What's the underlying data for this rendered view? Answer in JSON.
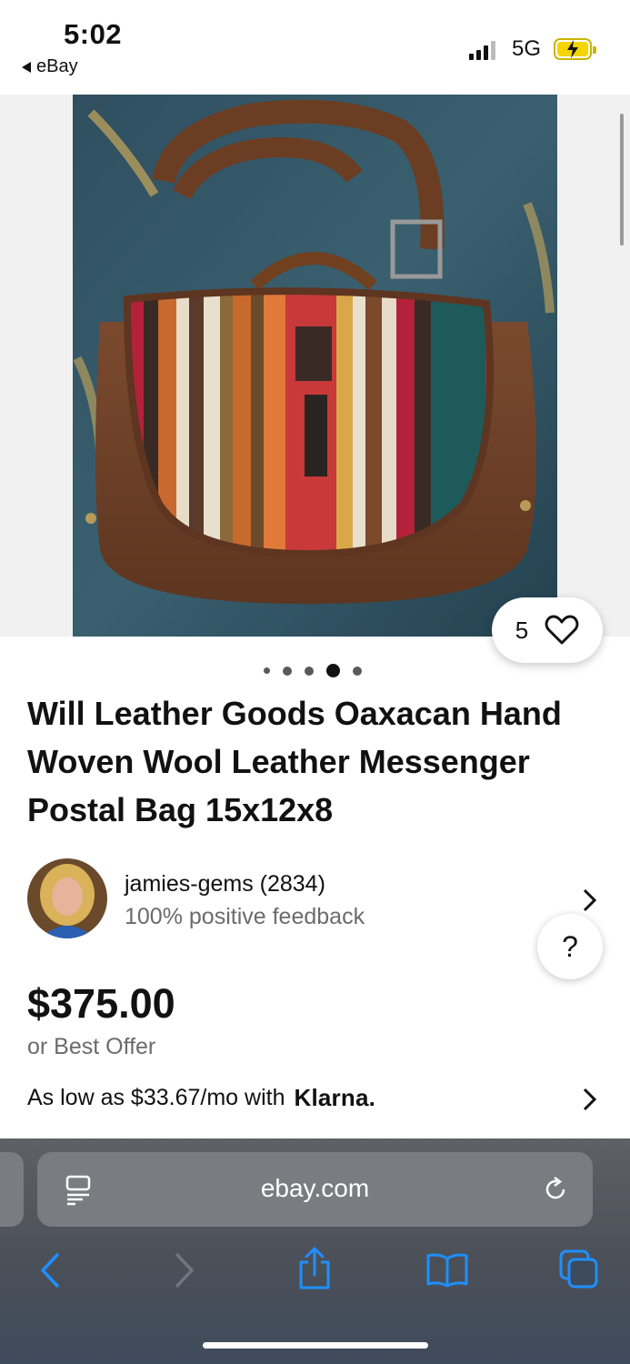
{
  "status_bar": {
    "time": "5:02",
    "back_app": "eBay",
    "network": "5G",
    "battery_state": "charging"
  },
  "gallery": {
    "photo_description_icon": "product-photo",
    "watch_count": "5",
    "page_dots": {
      "count": 5,
      "active_index": 3
    }
  },
  "listing": {
    "title": "Will Leather Goods Oaxacan Hand Woven Wool Leather Messenger Postal Bag 15x12x8",
    "price": "$375.00",
    "best_offer": "or Best Offer",
    "financing_text": "As low as $33.67/mo with",
    "financing_brand": "Klarna."
  },
  "seller": {
    "name": "jamies-gems (2834)",
    "feedback": "100% positive feedback"
  },
  "help_button": {
    "label": "?"
  },
  "browser": {
    "url": "ebay.com"
  },
  "colors": {
    "accent_blue": "#1f8fff",
    "text_primary": "#111111",
    "text_secondary": "#6b6b6b"
  }
}
